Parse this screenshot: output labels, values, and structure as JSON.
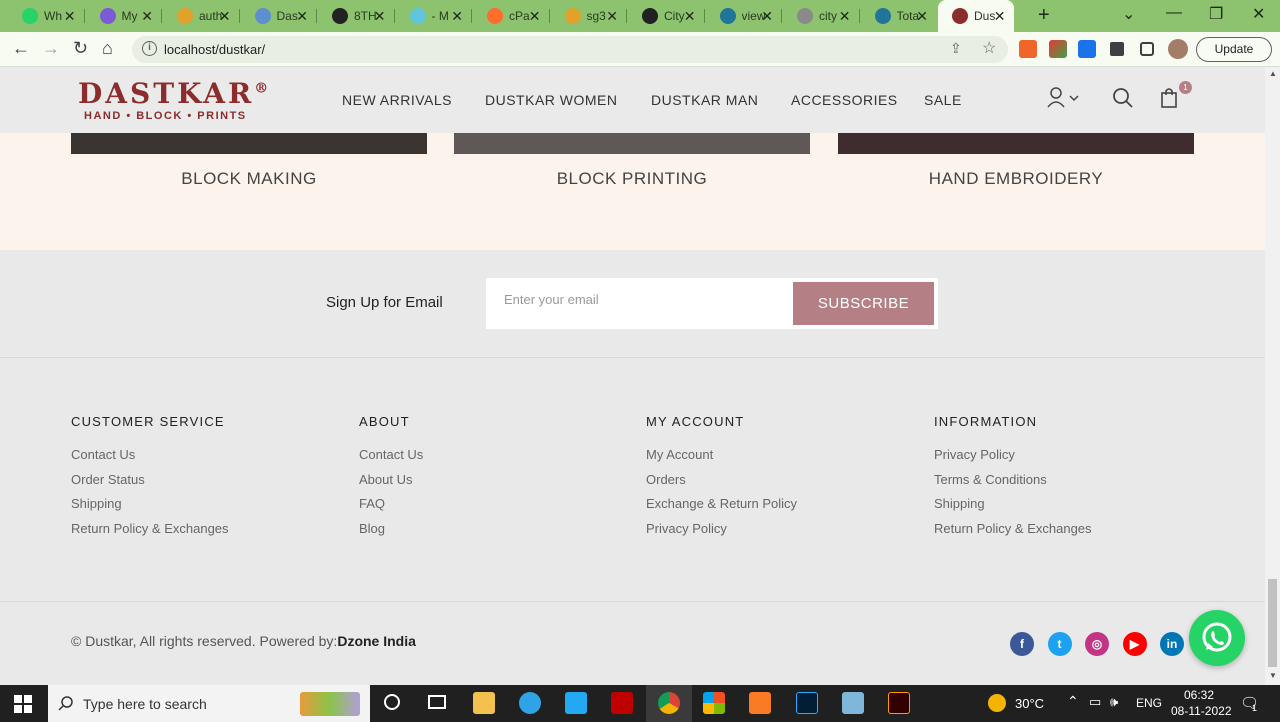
{
  "browser": {
    "tabs": [
      {
        "label": "Wh",
        "icon": "whatsapp-icon",
        "color": "#25d366"
      },
      {
        "label": "My",
        "icon": "app-icon",
        "color": "#7b5cd6"
      },
      {
        "label": "auth",
        "icon": "xampp-icon",
        "color": "#e2a12b"
      },
      {
        "label": "Das",
        "icon": "figure-icon",
        "color": "#5d8fd1"
      },
      {
        "label": "8TH",
        "icon": "github-icon",
        "color": "#222222"
      },
      {
        "label": "- M",
        "icon": "react-icon",
        "color": "#61c6db"
      },
      {
        "label": "cPa",
        "icon": "cpanel-icon",
        "color": "#ff6c2c"
      },
      {
        "label": "sg3",
        "icon": "xampp-icon",
        "color": "#e2a12b"
      },
      {
        "label": "City",
        "icon": "github-icon",
        "color": "#222222"
      },
      {
        "label": "view",
        "icon": "wordpress-icon",
        "color": "#21759b"
      },
      {
        "label": "city",
        "icon": "globe-icon",
        "color": "#8a8a8a"
      },
      {
        "label": "Tota",
        "icon": "wordpress-icon",
        "color": "#21759b"
      },
      {
        "label": "Dus",
        "icon": "dustkar-favicon-icon",
        "color": "#8c2d2d",
        "active": true
      }
    ],
    "url": "localhost/dustkar/",
    "update_label": "Update"
  },
  "site": {
    "logo": {
      "word": "DASTKAR",
      "registered": "®",
      "tagline": "HAND • BLOCK • PRINTS"
    },
    "nav": [
      "NEW ARRIVALS",
      "DUSTKAR WOMEN",
      "DUSTKAR MAN",
      "ACCESSORIES",
      "SALE"
    ],
    "cart_count": "1",
    "categories": [
      {
        "label": "BLOCK MAKING",
        "color": "#3b3531"
      },
      {
        "label": "BLOCK PRINTING",
        "color": "#5e5857"
      },
      {
        "label": "HAND EMBROIDERY",
        "color": "#3f2c2e"
      }
    ],
    "newsletter": {
      "label": "Sign Up for Email",
      "placeholder": "Enter your email",
      "button": "SUBSCRIBE"
    },
    "footer": {
      "columns": [
        {
          "heading": "CUSTOMER SERVICE",
          "links": [
            "Contact Us",
            "Order Status",
            "Shipping",
            "Return Policy & Exchanges"
          ]
        },
        {
          "heading": "ABOUT",
          "links": [
            "Contact Us",
            "About Us",
            "FAQ",
            "Blog"
          ]
        },
        {
          "heading": "MY ACCOUNT",
          "links": [
            "My Account",
            "Orders",
            "Exchange & Return Policy",
            "Privacy Policy"
          ]
        },
        {
          "heading": "INFORMATION",
          "links": [
            "Privacy Policy",
            "Terms & Conditions",
            "Shipping",
            "Return Policy & Exchanges"
          ]
        }
      ],
      "copyright_prefix": "© Dustkar, All rights reserved. Powered by:",
      "copyright_brand": "Dzone India",
      "social": [
        {
          "name": "facebook-icon",
          "glyph": "f",
          "color": "#3b5998"
        },
        {
          "name": "twitter-icon",
          "glyph": "t",
          "color": "#1da1f2"
        },
        {
          "name": "instagram-icon",
          "glyph": "◎",
          "color": "#c13584"
        },
        {
          "name": "youtube-icon",
          "glyph": "▶",
          "color": "#ff0000"
        },
        {
          "name": "linkedin-icon",
          "glyph": "in",
          "color": "#0077b5"
        }
      ]
    }
  },
  "taskbar": {
    "search_placeholder": "Type here to search",
    "weather": "30°C",
    "language": "ENG",
    "time": "06:32",
    "date": "08-11-2022",
    "notification_count": "1"
  }
}
